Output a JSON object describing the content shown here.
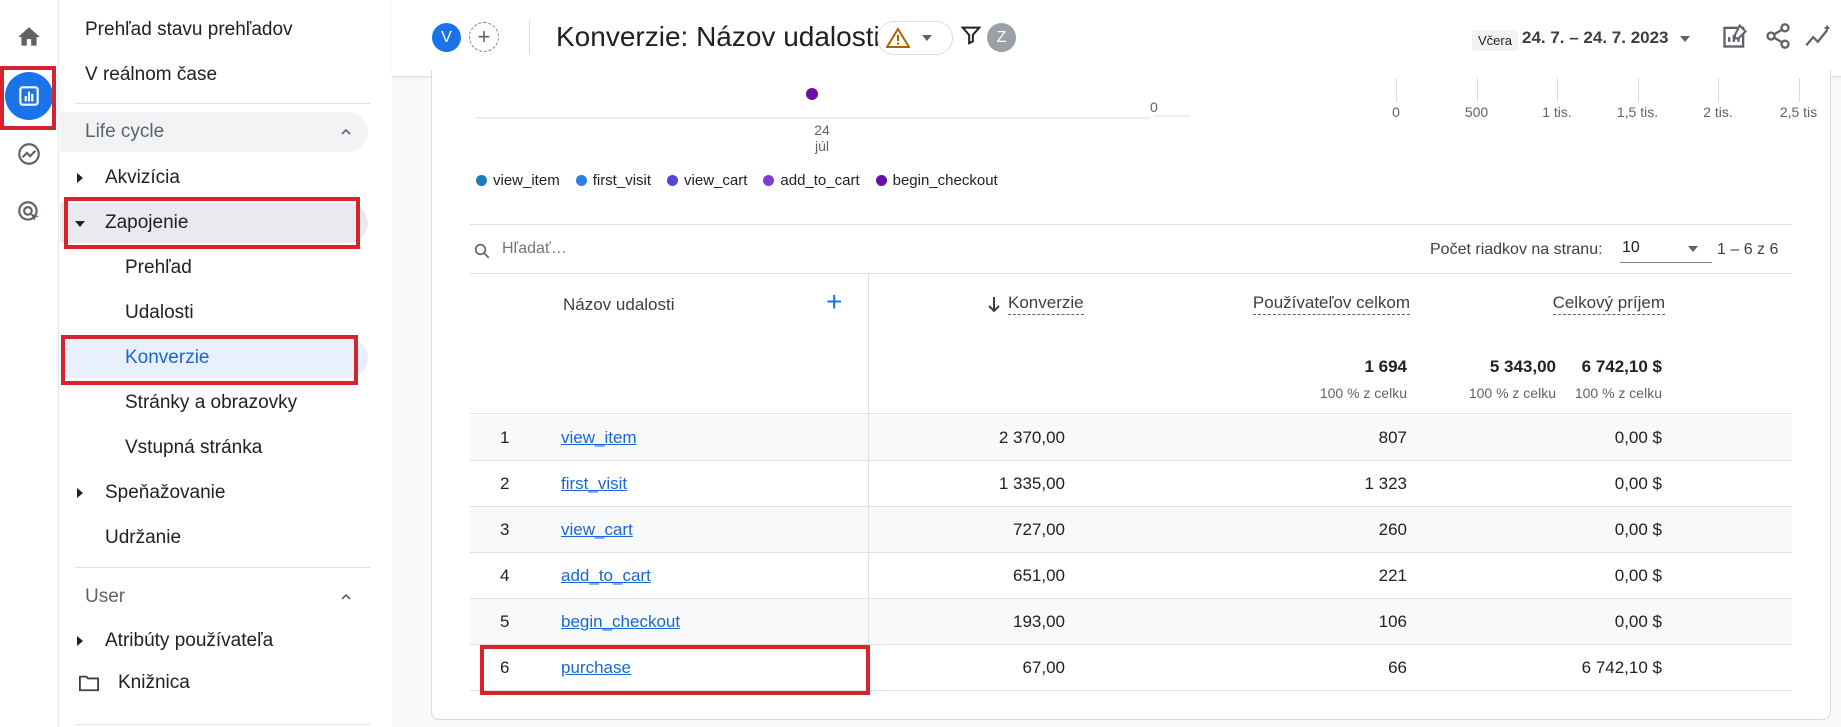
{
  "sidebar": {
    "overview_label": "Prehľad stavu prehľadov",
    "realtime_label": "V reálnom čase",
    "lifecycle_label": "Life cycle",
    "acquisition_label": "Akvizícia",
    "engagement_label": "Zapojenie",
    "engagement_children": {
      "overview": "Prehľad",
      "events": "Udalosti",
      "conversions": "Konverzie",
      "pages": "Stránky a obrazovky",
      "landing": "Vstupná stránka"
    },
    "monetization_label": "Speňažovanie",
    "retention_label": "Udržanie",
    "user_label": "User",
    "user_attributes_label": "Atribúty používateľa",
    "library_label": "Knižnica"
  },
  "header": {
    "avatar_v": "V",
    "avatar_z": "Z",
    "title": "Konverzie: Názov udalosti",
    "date_chip": "Včera",
    "date_range": "24. 7. – 24. 7. 2023"
  },
  "chart": {
    "x_tick_day": "24",
    "x_tick_month": "júl",
    "left_zero": "0",
    "bar_axis_ticks": [
      "0",
      "500",
      "1 tis.",
      "1,5 tis.",
      "2 tis.",
      "2,5 tis"
    ],
    "legend": [
      {
        "label": "view_item",
        "color": "#1a7bbf"
      },
      {
        "label": "first_visit",
        "color": "#2e7de9"
      },
      {
        "label": "view_cart",
        "color": "#5045d9"
      },
      {
        "label": "add_to_cart",
        "color": "#7b3fd6"
      },
      {
        "label": "begin_checkout",
        "color": "#6a0fa6"
      }
    ]
  },
  "table": {
    "search_placeholder": "Hľadať…",
    "rows_per_page_label": "Počet riadkov na stranu:",
    "rows_per_page_value": "10",
    "pager": "1 – 6 z 6",
    "headers": {
      "event_name": "Názov udalosti",
      "conversions": "Konverzie",
      "total_users": "Používateľov celkom",
      "total_revenue": "Celkový príjem"
    },
    "totals": {
      "conversions": "5 343,00",
      "conversions_sub": "100 % z celku",
      "users": "1 694",
      "users_sub": "100 % z celku",
      "revenue": "6 742,10 $",
      "revenue_sub": "100 % z celku"
    },
    "rows": [
      {
        "idx": "1",
        "name": "view_item",
        "conversions": "2 370,00",
        "users": "807",
        "revenue": "0,00 $"
      },
      {
        "idx": "2",
        "name": "first_visit",
        "conversions": "1 335,00",
        "users": "1 323",
        "revenue": "0,00 $"
      },
      {
        "idx": "3",
        "name": "view_cart",
        "conversions": "727,00",
        "users": "260",
        "revenue": "0,00 $"
      },
      {
        "idx": "4",
        "name": "add_to_cart",
        "conversions": "651,00",
        "users": "221",
        "revenue": "0,00 $"
      },
      {
        "idx": "5",
        "name": "begin_checkout",
        "conversions": "193,00",
        "users": "106",
        "revenue": "0,00 $"
      },
      {
        "idx": "6",
        "name": "purchase",
        "conversions": "67,00",
        "users": "66",
        "revenue": "6 742,10 $"
      }
    ]
  },
  "colors": {
    "accent": "#1a73e8",
    "link": "#1967d2",
    "highlight_red": "#d7232e"
  }
}
